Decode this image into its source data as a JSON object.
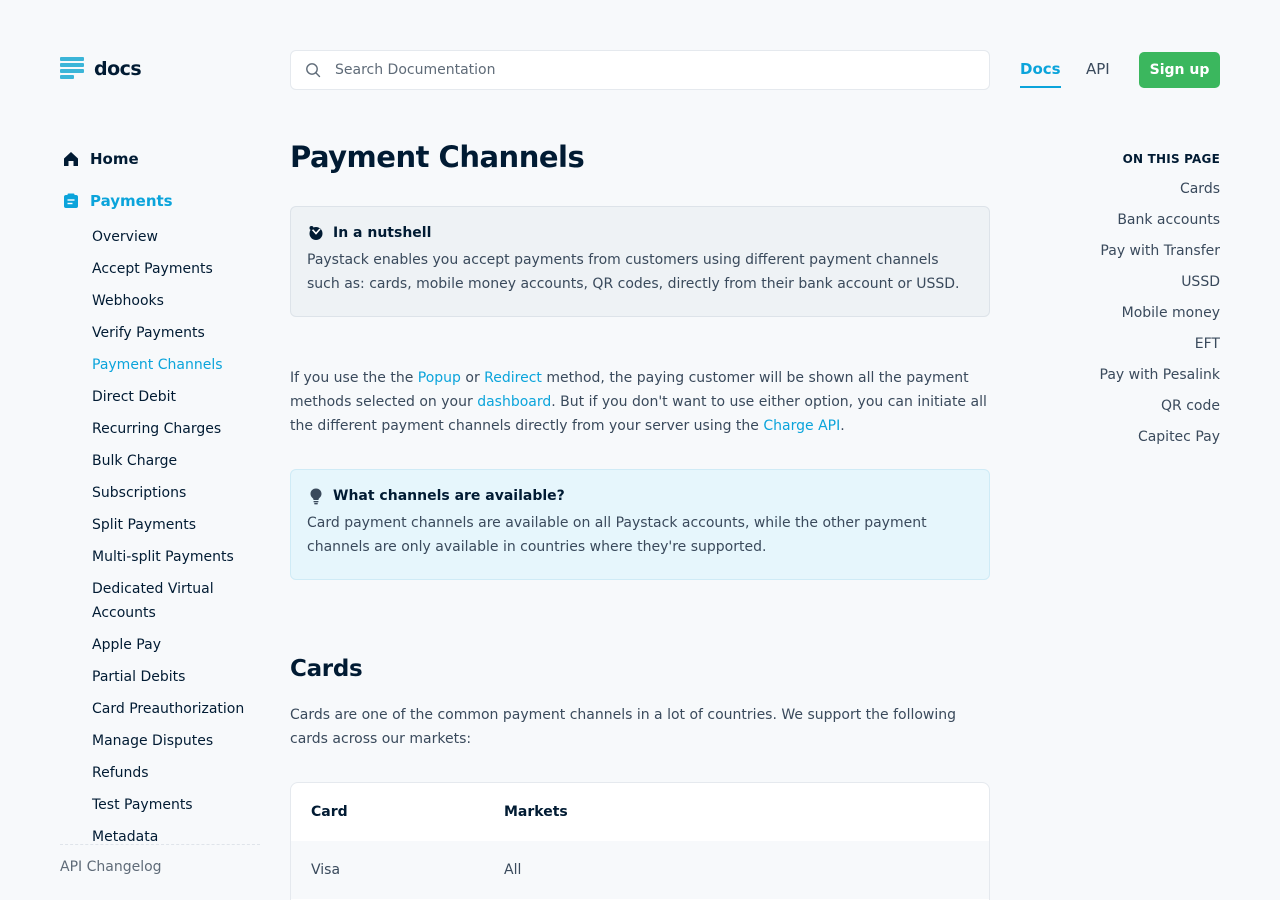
{
  "header": {
    "logo_text": "docs",
    "search_placeholder": "Search Documentation",
    "nav_docs": "Docs",
    "nav_api": "API",
    "signup_label": "Sign up"
  },
  "sidebar": {
    "home_label": "Home",
    "payments_label": "Payments",
    "items": [
      {
        "label": "Overview"
      },
      {
        "label": "Accept Payments"
      },
      {
        "label": "Webhooks"
      },
      {
        "label": "Verify Payments"
      },
      {
        "label": "Payment Channels",
        "active": true
      },
      {
        "label": "Direct Debit"
      },
      {
        "label": "Recurring Charges"
      },
      {
        "label": "Bulk Charge"
      },
      {
        "label": "Subscriptions"
      },
      {
        "label": "Split Payments"
      },
      {
        "label": "Multi-split Payments"
      },
      {
        "label": "Dedicated Virtual Accounts"
      },
      {
        "label": "Apple Pay"
      },
      {
        "label": "Partial Debits"
      },
      {
        "label": "Card Preauthorization"
      },
      {
        "label": "Manage Disputes"
      },
      {
        "label": "Refunds"
      },
      {
        "label": "Test Payments"
      },
      {
        "label": "Metadata"
      }
    ],
    "changelog_label": "API Changelog"
  },
  "main": {
    "title": "Payment Channels",
    "nutshell": {
      "title": "In a nutshell",
      "body": "Paystack enables you accept payments from customers using different payment channels such as: cards, mobile money accounts, QR codes, directly from their bank account or USSD."
    },
    "intro": {
      "t1": "If you use the the ",
      "link_popup": "Popup",
      "t2": " or ",
      "link_redirect": "Redirect",
      "t3": " method, the paying customer will be shown all the payment methods selected on your ",
      "link_dashboard": "dashboard",
      "t4": ". But if you don't want to use either option, you can initiate all the different payment channels directly from your server using the ",
      "link_charge_api": "Charge API",
      "t5": "."
    },
    "channels": {
      "title": "What channels are available?",
      "body": "Card payment channels are available on all Paystack accounts, while the other payment channels are only available in countries where they're supported."
    },
    "cards_heading": "Cards",
    "cards_intro": "Cards are one of the common payment channels in a lot of countries. We support the following cards across our markets:",
    "table": {
      "headers": [
        "Card",
        "Markets"
      ],
      "rows": [
        [
          "Visa",
          "All"
        ]
      ]
    }
  },
  "toc": {
    "title": "ON THIS PAGE",
    "items": [
      "Cards",
      "Bank accounts",
      "Pay with Transfer",
      "USSD",
      "Mobile money",
      "EFT",
      "Pay with Pesalink",
      "QR code",
      "Capitec Pay"
    ]
  },
  "colors": {
    "accent": "#0ba4db",
    "signup": "#3bb75e",
    "text": "#011b33",
    "page_bg": "#f7f9fb"
  },
  "icons": {
    "logo": "docs-logo-icon",
    "search": "search-icon",
    "home": "home-icon",
    "payments": "payments-icon",
    "nutshell": "nutshell-icon",
    "channels": "lightbulb-icon"
  }
}
